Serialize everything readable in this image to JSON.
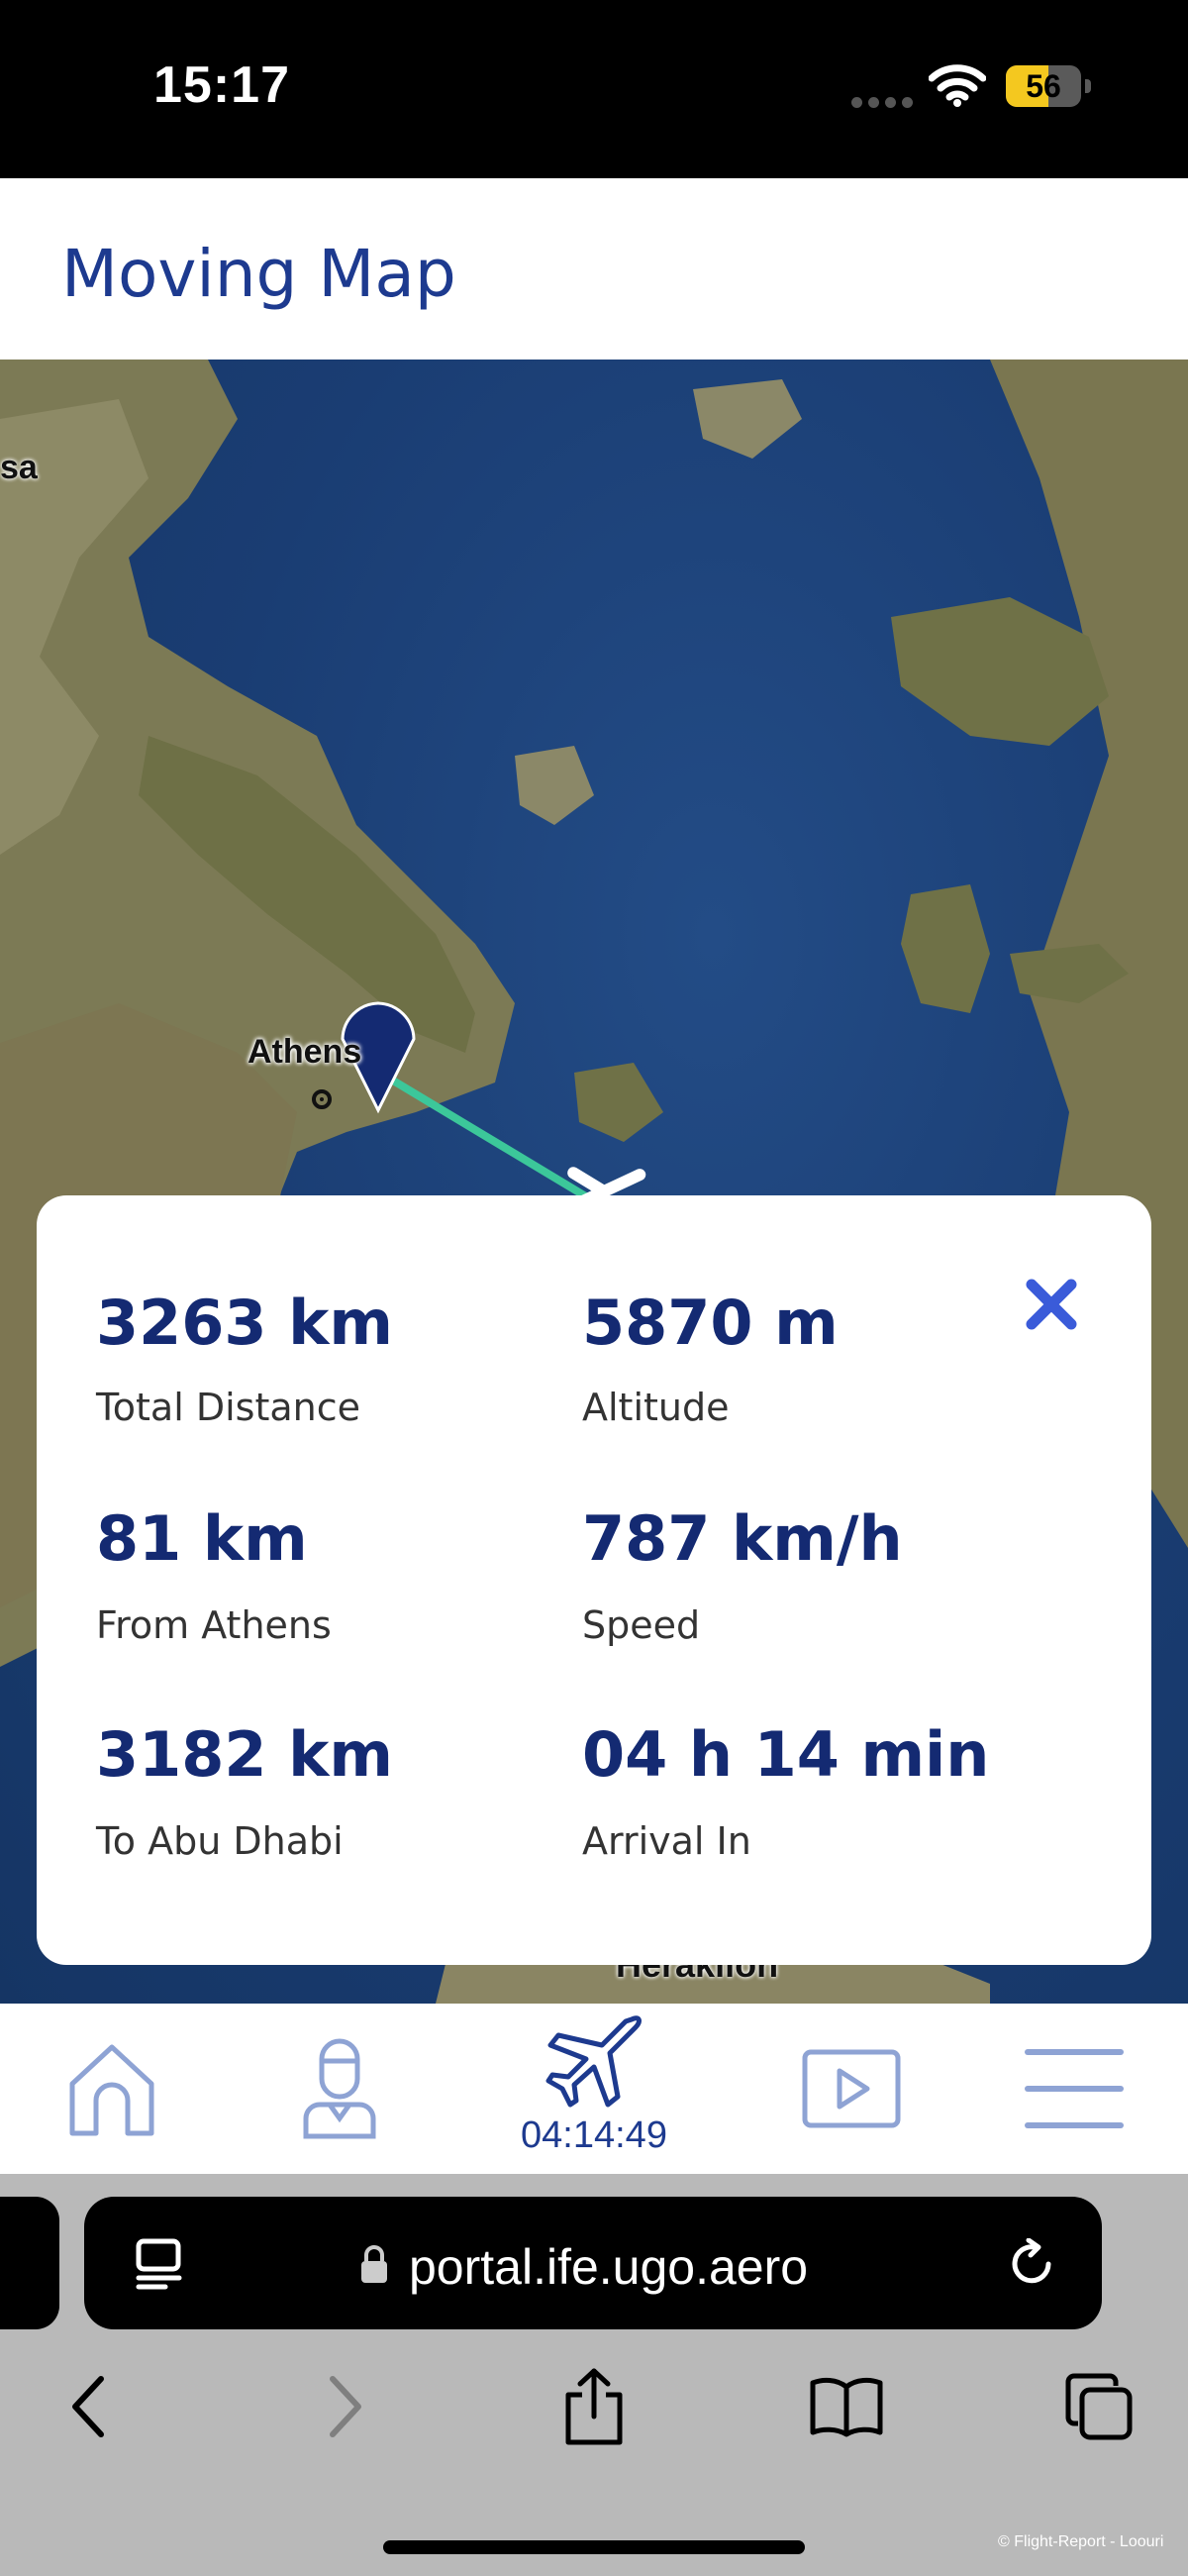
{
  "status_bar": {
    "time": "15:17",
    "battery_level": 56,
    "battery_label": "56"
  },
  "header": {
    "title": "Moving Map"
  },
  "map": {
    "city_labels": {
      "athens": "Athens",
      "left_edge": "sa",
      "heraklion": "Heraklion"
    }
  },
  "flight_info": {
    "total_distance": {
      "value": "3263 km",
      "label": "Total Distance"
    },
    "altitude": {
      "value": "5870 m",
      "label": "Altitude"
    },
    "from_origin": {
      "value": "81 km",
      "label": "From Athens"
    },
    "speed": {
      "value": "787 km/h",
      "label": "Speed"
    },
    "to_destination": {
      "value": "3182 km",
      "label": "To Abu Dhabi"
    },
    "arrival": {
      "value": "04 h 14 min",
      "label": "Arrival In"
    }
  },
  "bottom_nav": {
    "items": [
      {
        "icon": "home-icon"
      },
      {
        "icon": "profile-icon"
      },
      {
        "icon": "airplane-icon",
        "timer": "04:14:49"
      },
      {
        "icon": "play-icon"
      },
      {
        "icon": "menu-icon"
      }
    ]
  },
  "browser": {
    "url": "portal.ife.ugo.aero",
    "credit": "© Flight-Report - Loouri"
  },
  "colors": {
    "brand": "#1d3a8f",
    "route": "#3cc79a",
    "close": "#3a5bd9",
    "battery": "#f4c81f"
  }
}
